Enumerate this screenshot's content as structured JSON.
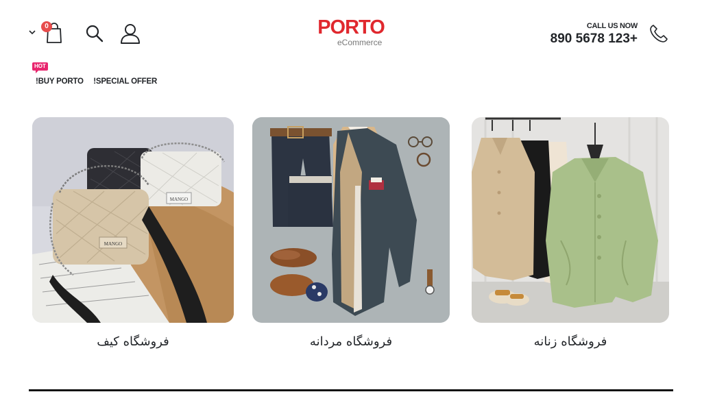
{
  "header": {
    "cart_count": "0",
    "logo_text": "PORTO",
    "logo_subtext": "eCommerce",
    "call_label": "CALL US NOW",
    "call_number": "890 5678 123+"
  },
  "promo": {
    "hot_badge": "HOT",
    "links": [
      "!BUY PORTO",
      "!SPECIAL OFFER"
    ]
  },
  "categories": [
    {
      "title": "فروشگاه کیف",
      "image": "handbags-photo"
    },
    {
      "title": "فروشگاه مردانه",
      "image": "menswear-flatlay-photo"
    },
    {
      "title": "فروشگاه زنانه",
      "image": "womens-shirts-photo"
    }
  ],
  "colors": {
    "brand": "#e0282e",
    "badge": "#e74c4c",
    "hot": "#e8266e",
    "text": "#222529"
  }
}
